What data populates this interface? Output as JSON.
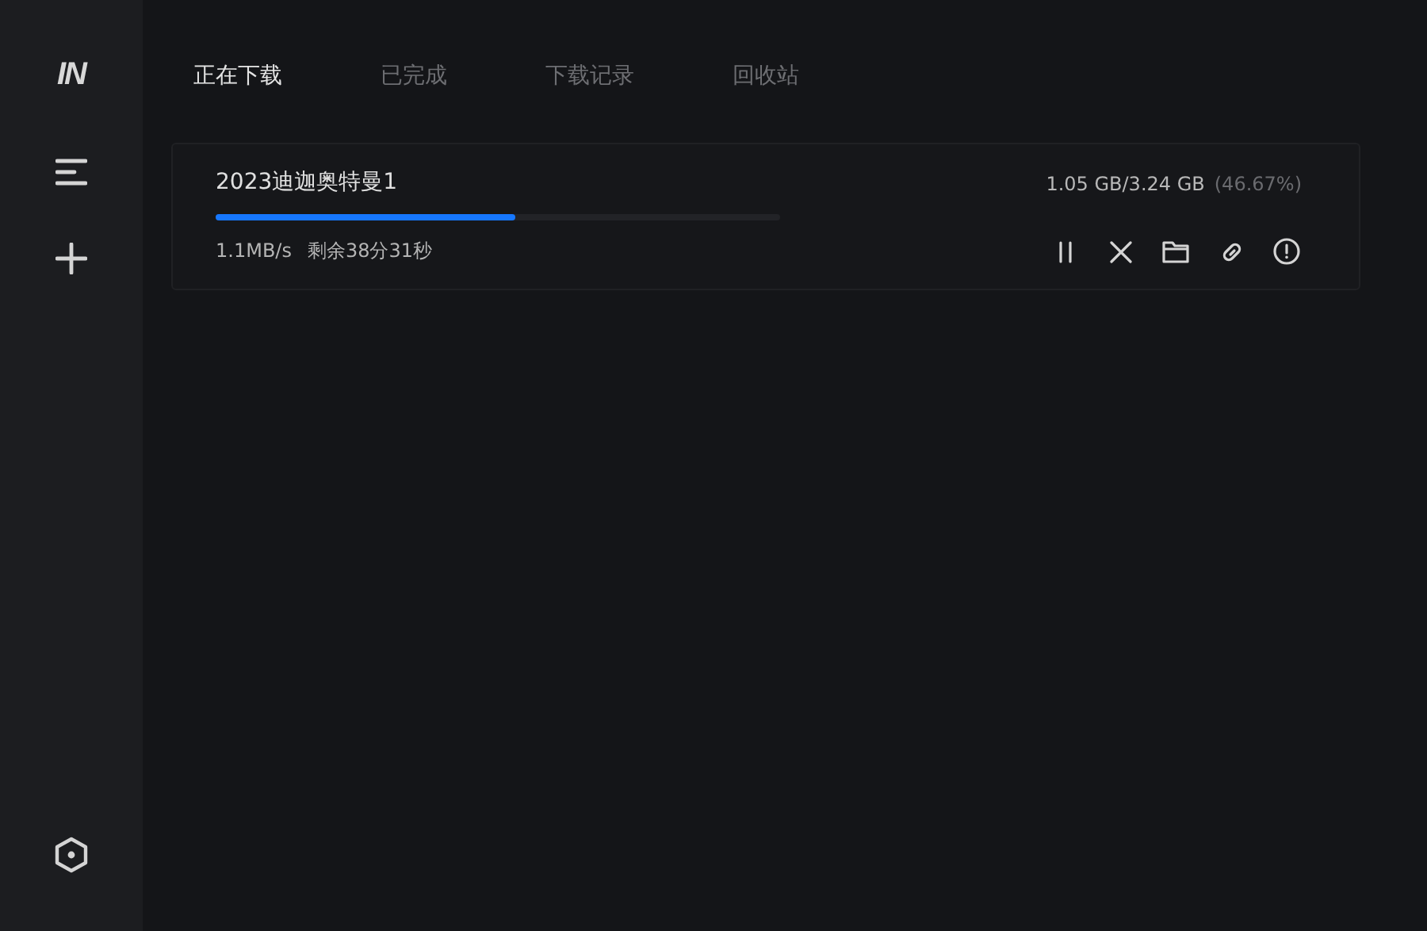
{
  "sidebar": {
    "logo": "IN"
  },
  "tabs": [
    {
      "label": "正在下载",
      "selected": true
    },
    {
      "label": "已完成",
      "selected": false
    },
    {
      "label": "下载记录",
      "selected": false
    },
    {
      "label": "回收站",
      "selected": false
    }
  ],
  "downloads": [
    {
      "name": "2023迪迦奥特曼1",
      "size": "1.05 GB/3.24 GB",
      "percent": "(46.67%)",
      "level": 0.53,
      "speed": "1.1MB/s",
      "remaining": "剩余38分31秒"
    }
  ]
}
